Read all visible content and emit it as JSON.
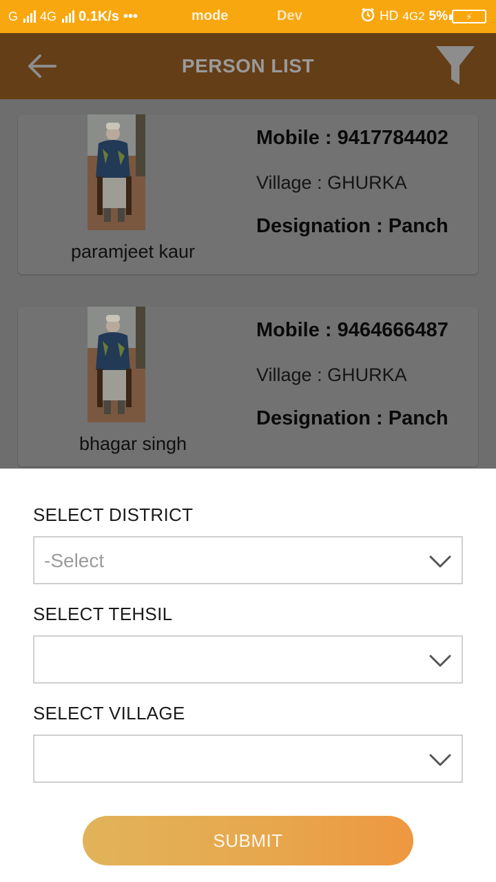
{
  "status_bar": {
    "carrier_g": "G",
    "network_4g": "4G",
    "speed": "0.1K/s",
    "dots": "•••",
    "mode_text": "mode",
    "dev_text": "Dev",
    "hd": "HD",
    "net_right": "4G2",
    "battery_percent": "5%"
  },
  "app_bar": {
    "title": "PERSON LIST",
    "background": "#643e17"
  },
  "persons": [
    {
      "name": "paramjeet kaur",
      "mobile": "Mobile : 9417784402",
      "village": "Village : GHURKA",
      "designation": "Designation : Panch"
    },
    {
      "name": "bhagar singh",
      "mobile": "Mobile : 9464666487",
      "village": "Village : GHURKA",
      "designation": "Designation : Panch"
    }
  ],
  "filter_sheet": {
    "district_label": "SELECT DISTRICT",
    "district_value": "-Select",
    "tehsil_label": "SELECT TEHSIL",
    "tehsil_value": "",
    "village_label": "SELECT VILLAGE",
    "village_value": "",
    "submit_label": "SUBMIT"
  },
  "colors": {
    "status_bar": "#f9a70f",
    "overlay_list": "#6e6e6e",
    "submit_gradient_start": "#e2b35a",
    "submit_gradient_end": "#ee9741"
  },
  "icons": {
    "back": "arrow-left-icon",
    "filter": "filter-funnel-icon",
    "dropdown": "chevron-down-icon",
    "alarm": "alarm-clock-icon",
    "battery": "battery-charging-icon"
  }
}
